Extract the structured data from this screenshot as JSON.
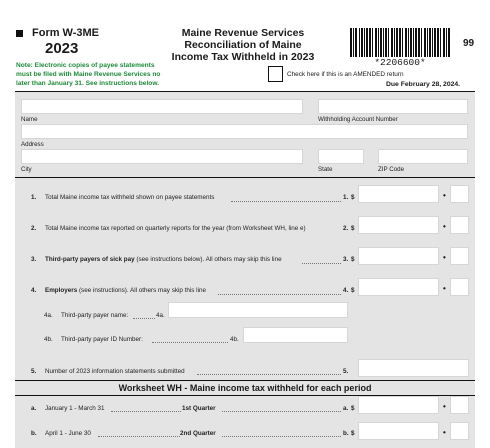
{
  "header": {
    "form_id": "Form W-3ME",
    "year": "2023",
    "title_line1": "Maine Revenue Services",
    "title_line2": "Reconciliation of Maine",
    "title_line3": "Income Tax Withheld in 2023",
    "page_code": "99",
    "barcode_number": "*2206600*",
    "note_line1": "Note: Electronic copies of payee statements",
    "note_line2": "must be filed with Maine Revenue Services no",
    "note_line3": "later than January 31. See instructions below.",
    "amended_label": "Check here if this is an AMENDED return",
    "due_date": "Due February 28, 2024."
  },
  "id_fields": {
    "name_label": "Name",
    "withholding_label": "Withholding Account Number",
    "address_label": "Address",
    "city_label": "City",
    "state_label": "State",
    "zip_label": "ZIP Code"
  },
  "lines": {
    "l1": {
      "num": "1.",
      "text": "Total Maine income tax withheld shown on payee statements",
      "ref": "1.",
      "dollar": "$"
    },
    "l2": {
      "num": "2.",
      "text": "Total Maine income tax reported on quarterly reports for the year (from Worksheet WH, line e)",
      "ref": "2.",
      "dollar": "$"
    },
    "l3": {
      "num": "3.",
      "bold": "Third-party payers of sick pay",
      "text": " (see instructions below). All others may skip this line",
      "ref": "3.",
      "dollar": "$"
    },
    "l4": {
      "num": "4.",
      "bold": "Employers",
      "text": " (see instructions). All others may skip this line",
      "ref": "4.",
      "dollar": "$"
    },
    "l4a": {
      "num": "4a.",
      "text": "Third-party payer name:",
      "ref": "4a."
    },
    "l4b": {
      "num": "4b.",
      "text": "Third-party payer ID Number:",
      "ref": "4b."
    },
    "l5": {
      "num": "5.",
      "text": "Number of 2023 information statements submitted",
      "ref": "5."
    }
  },
  "worksheet": {
    "title": "Worksheet WH - Maine income tax withheld for each period",
    "rows": [
      {
        "letter": "a.",
        "period": "January 1 - March 31",
        "quarter": "1st Quarter",
        "ref": "a.",
        "dollar": "$"
      },
      {
        "letter": "b.",
        "period": "April 1 - June 30",
        "quarter": "2nd Quarter",
        "ref": "b.",
        "dollar": "$"
      }
    ]
  },
  "colors": {
    "gray_bg": "#e4e4e4",
    "note_green": "#1e8a3a"
  }
}
